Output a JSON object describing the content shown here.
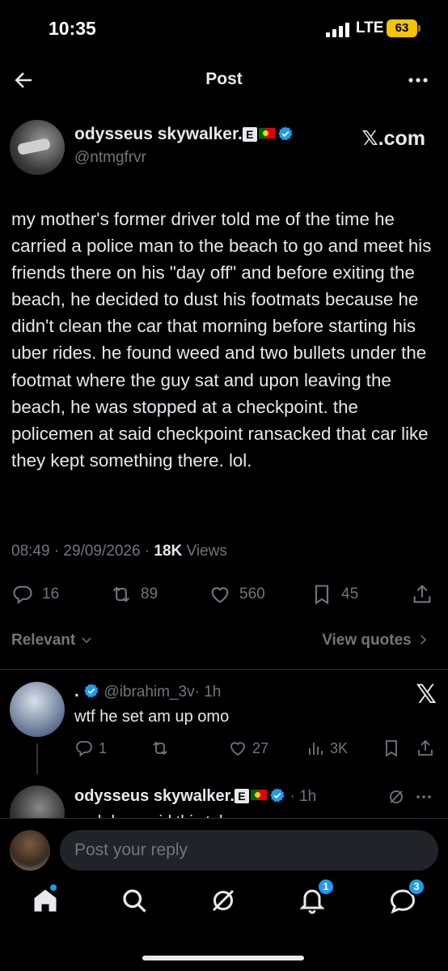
{
  "status_bar": {
    "time": "10:35",
    "network": "LTE",
    "battery": "63"
  },
  "header": {
    "title": "Post"
  },
  "post": {
    "author": {
      "display_name": "odysseus skywalker.",
      "handle": "@ntmgfrvr",
      "badge_letter": "E"
    },
    "source_label": "𝕏.com",
    "text": "my mother's former driver told me of the time he carried a police man to the beach to go and meet his friends there on his \"day off\" and before exiting the beach, he decided to dust his footmats because he didn't clean the car that morning before starting his uber rides. he found weed and two bullets under the footmat where the guy sat and upon leaving the beach, he was stopped at a checkpoint. the policemen at said checkpoint ransacked that car like they kept something there. lol.",
    "timestamp": "08:49 · 29/09/2026 · ",
    "views_count": "18K",
    "views_label": " Views",
    "stats": {
      "replies": "16",
      "reposts": "89",
      "likes": "560",
      "bookmarks": "45"
    }
  },
  "filters": {
    "sort_label": "Relevant",
    "view_quotes_label": "View quotes"
  },
  "replies": [
    {
      "display_name": ".",
      "handle": "@ibrahim_3v",
      "time": "· 1h",
      "text": "wtf he set am up omo",
      "stats": {
        "replies": "1",
        "reposts": "",
        "likes": "27",
        "views": "3K"
      }
    },
    {
      "display_name": "odysseus skywalker.",
      "badge_letter": "E",
      "time": "· 1h",
      "text": "and dem said this tal..."
    }
  ],
  "compose": {
    "placeholder": "Post your reply"
  },
  "nav": {
    "notifications_badge": "1",
    "messages_badge": "3"
  },
  "colors": {
    "accent": "#1d9bf0",
    "muted": "#71767b",
    "text": "#e7e9ea",
    "battery": "#f4c400"
  }
}
